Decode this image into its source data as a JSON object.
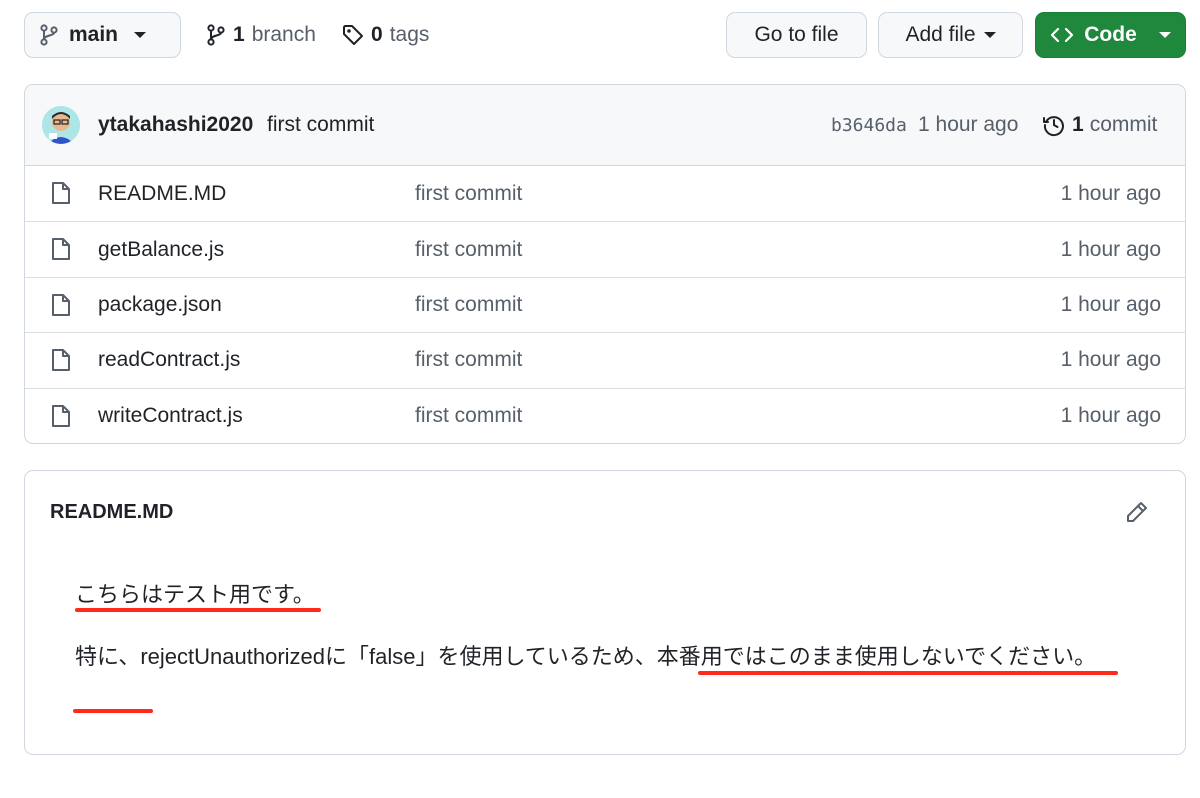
{
  "toolbar": {
    "branch_name": "main",
    "branches_count": "1",
    "branches_label": "branch",
    "tags_count": "0",
    "tags_label": "tags",
    "go_to_file": "Go to file",
    "add_file": "Add file",
    "code": "Code"
  },
  "commit": {
    "author": "ytakahashi2020",
    "message": "first commit",
    "sha": "b3646da",
    "time": "1 hour ago",
    "count": "1",
    "count_label": "commit"
  },
  "files": [
    {
      "name": "README.MD",
      "message": "first commit",
      "time": "1 hour ago"
    },
    {
      "name": "getBalance.js",
      "message": "first commit",
      "time": "1 hour ago"
    },
    {
      "name": "package.json",
      "message": "first commit",
      "time": "1 hour ago"
    },
    {
      "name": "readContract.js",
      "message": "first commit",
      "time": "1 hour ago"
    },
    {
      "name": "writeContract.js",
      "message": "first commit",
      "time": "1 hour ago"
    }
  ],
  "readme": {
    "title": "README.MD",
    "paragraph1": "こちらはテスト用です。",
    "paragraph2": "特に、rejectUnauthorizedに「false」を使用しているため、本番用ではこのまま使用しないでください。"
  },
  "colors": {
    "primary_button": "#1f883d",
    "annotation_underline": "#ff2a1a"
  },
  "icons": [
    "git-branch-icon",
    "tag-icon",
    "code-icon",
    "history-icon",
    "file-icon",
    "pencil-icon"
  ]
}
